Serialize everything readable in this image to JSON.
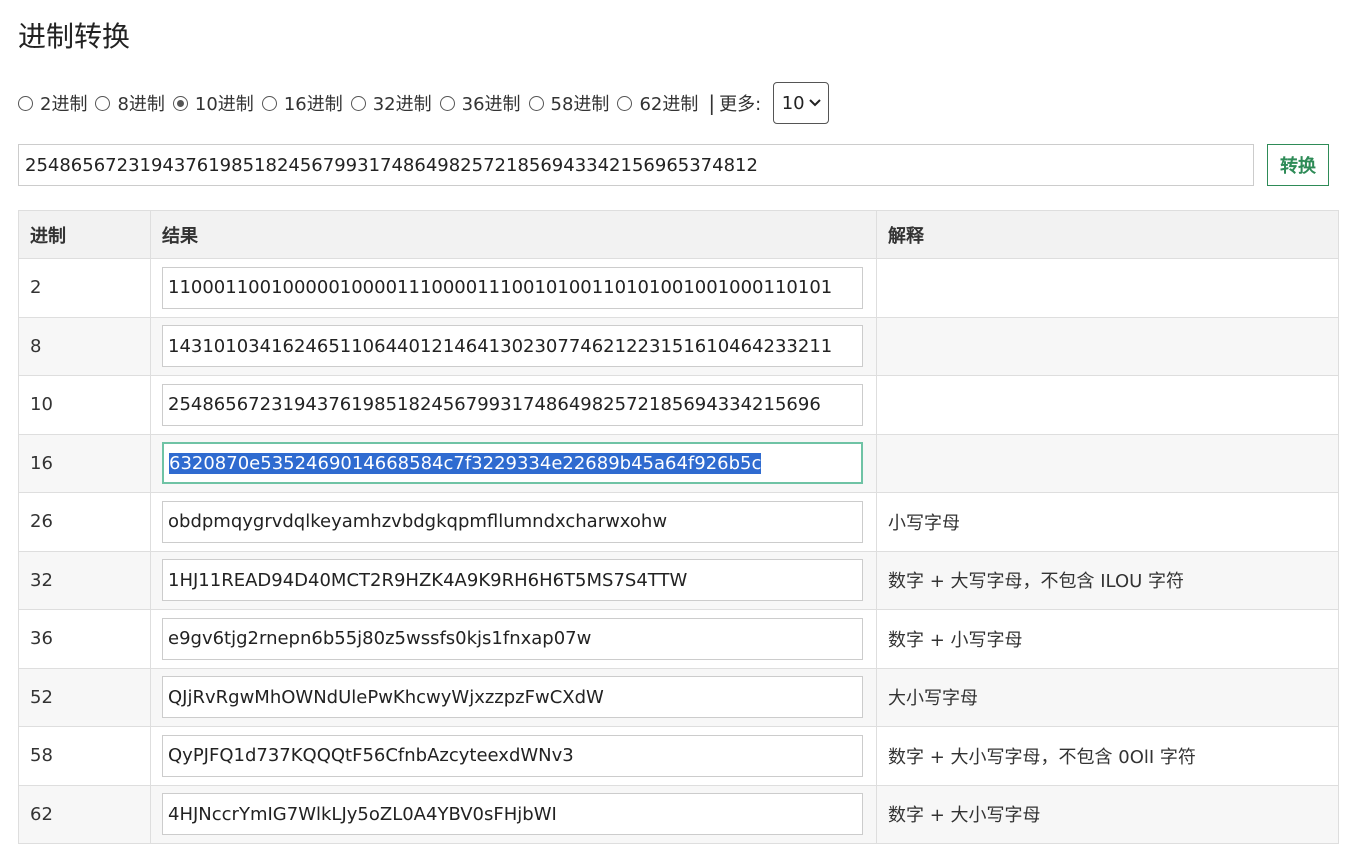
{
  "page": {
    "title": "进制转换"
  },
  "radios": [
    {
      "label": "2进制",
      "checked": false
    },
    {
      "label": "8进制",
      "checked": false
    },
    {
      "label": "10进制",
      "checked": true
    },
    {
      "label": "16进制",
      "checked": false
    },
    {
      "label": "32进制",
      "checked": false
    },
    {
      "label": "36进制",
      "checked": false
    },
    {
      "label": "58进制",
      "checked": false
    },
    {
      "label": "62进制",
      "checked": false
    }
  ],
  "separator": "|",
  "more": {
    "label": "更多:",
    "selected": "10"
  },
  "input": {
    "value": "25486567231943761985182456799317486498257218569433421569653748​12"
  },
  "convert_button": "转换",
  "table": {
    "headers": [
      "进制",
      "结果",
      "解释"
    ],
    "rows": [
      {
        "base": "2",
        "result": "1100011001000001000011100001110010100110101001001000110101",
        "explain": ""
      },
      {
        "base": "8",
        "result": "1431010341624651106440121464130230774621223151610464233211",
        "explain": ""
      },
      {
        "base": "10",
        "result": "254865672319437619851824567993174864982572185694334215696",
        "explain": ""
      },
      {
        "base": "16",
        "result": "6320870e5352469014668584c7f3229334e22689b45a64f926b5c",
        "explain": ""
      },
      {
        "base": "26",
        "result": "obdpmqygrvdqlkeyamhzvbdgkqpmfllumndxcharwxohw",
        "explain": "小写字母"
      },
      {
        "base": "32",
        "result": "1HJ11READ94D40MCT2R9HZK4A9K9RH6H6T5MS7S4TTW",
        "explain": "数字 + 大写字母，不包含 ILOU 字符"
      },
      {
        "base": "36",
        "result": "e9gv6tjg2rnepn6b55j80z5wssfs0kjs1fnxap07w",
        "explain": "数字 + 小写字母"
      },
      {
        "base": "52",
        "result": "QJjRvRgwMhOWNdUlePwKhcwyWjxzzpzFwCXdW",
        "explain": "大小写字母"
      },
      {
        "base": "58",
        "result": "QyPJFQ1d737KQQQtF56CfnbAzcyteexdWNv3",
        "explain": "数字 + 大小写字母，不包含 0OlI 字符"
      },
      {
        "base": "62",
        "result": "4HJNccrYmIG7WlkLJy5oZL0A4YBV0sFHjbWI",
        "explain": "数字 + 大小写字母"
      }
    ]
  }
}
